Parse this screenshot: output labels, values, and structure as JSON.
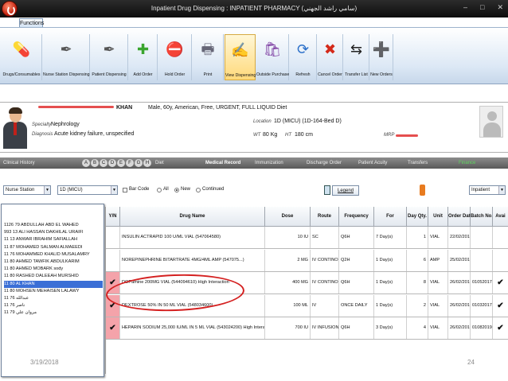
{
  "window": {
    "title": "Inpatient Drug Dispensing : INPATIENT PHARMACY (سامي راشد الجهني)"
  },
  "window_buttons": [
    "–",
    "□",
    "✕"
  ],
  "ribbon_tab": "Functions",
  "toolbar": [
    {
      "label": "Drugs/Consumables",
      "icon": "pill-icon",
      "glyph": "💊",
      "color": "#c8281e"
    },
    {
      "label": "Nurse Station Dispensing",
      "icon": "pen-icon",
      "glyph": "✒",
      "color": "#555"
    },
    {
      "label": "Patient Dispensing",
      "icon": "pen-icon",
      "glyph": "✒",
      "color": "#555"
    },
    {
      "label": "Add Order",
      "icon": "plus-icon",
      "glyph": "✚",
      "color": "#3aa52e"
    },
    {
      "label": "Hold Order",
      "icon": "stop-icon",
      "glyph": "⛔",
      "color": "#d42a1a"
    },
    {
      "label": "Print",
      "icon": "printer-icon",
      "glyph": "🖶",
      "color": "#667"
    },
    {
      "label": "View Dispensing",
      "icon": "pen-paper-icon",
      "glyph": "✍",
      "color": "#666"
    },
    {
      "label": "Outside Purchase",
      "icon": "bag-icon",
      "glyph": "🛍",
      "color": "#7b3aa0"
    },
    {
      "label": "Refresh",
      "icon": "refresh-icon",
      "glyph": "⟳",
      "color": "#2a6fc9"
    },
    {
      "label": "Cancel Order",
      "icon": "cancel-icon",
      "glyph": "✖",
      "color": "#d42a1a"
    },
    {
      "label": "Transfer List",
      "icon": "arrows-icon",
      "glyph": "⇆",
      "color": "#222"
    },
    {
      "label": "New Orders",
      "icon": "new-orders-icon",
      "glyph": "➕",
      "color": "#e0551f"
    }
  ],
  "patient": {
    "name": "KHAN",
    "summary": "Male, 60y, American, Free, URGENT, FULL LIQUID Diet",
    "specialty_label": "Specialty",
    "specialty": "Nephrology",
    "diagnosis_label": "Diagnosis",
    "diagnosis": "Acute kidney failure, unspecified",
    "location_label": "Location",
    "location": "1D (MICU) (1D-164-Bed D)",
    "wt_label": "WT",
    "wt": "80 Kg",
    "ht_label": "HT",
    "ht": "180 cm",
    "mrp_label": "MRP"
  },
  "nav": {
    "clinical_history": "Clinical History",
    "letters": [
      "A",
      "B",
      "C",
      "D",
      "E",
      "F",
      "G",
      "H"
    ],
    "diet": "Diet",
    "medical_record": "Medical Record",
    "immunization": "Immunization",
    "discharge_order": "Discharge Order",
    "patient_acuity": "Patient Acuity",
    "transfers": "Transfers",
    "finance": "Finance"
  },
  "filters": {
    "station_combo": "Nurse Station",
    "unit_combo": "1D (MICU)",
    "barcode_label": "Bar Code",
    "radio_all": "All",
    "radio_new": "New",
    "radio_continued": "Continued",
    "legend": "Legend",
    "type_combo": "Inpatient"
  },
  "patient_list": [
    "1126 79 ABDULLAH ABD EL WAHED",
    "993 13 ALI HASSAN DAKHILAL URAIFI",
    "11 13 ANWAR IBRAHIM SAFIALLAH",
    "11 87 MOHAMED SALMAN ALMAEEDI",
    "11 76 MOHAMMED KHALID MUSALAMRY",
    "11 80 AHMED TAWFIK ABDULKARIM",
    "11 80 AHMED MOBARK sody",
    "11 80 RASHED DALEEAH MURSHID",
    "11 80 AL KHAN",
    "11 80 MOHSEN MEHAISEN LALAWY",
    "11 76 عبدالله",
    "11 76 ناصر",
    "11 79 مروان علي"
  ],
  "grid": {
    "headers": [
      "Y/N",
      "Drug Name",
      "Dose",
      "Route",
      "Frequency",
      "For",
      "Day Qty.",
      "Unit",
      "Order Date",
      "Batch No.",
      "Avai"
    ],
    "rows": [
      {
        "yn": "",
        "drug": "INSULIN ACTRAPID 100 U/ML VIAL (547064580)",
        "dose": "10 IU",
        "route": "SC",
        "freq": "Q6H",
        "for": "7 Day(s)",
        "qty": "1",
        "unit": "VIAL",
        "date": "22/02/2017",
        "batch": "",
        "avail": ""
      },
      {
        "yn": "",
        "drug": "NOREPINEPHRINE BITARTRATE 4MG/4ML AMP (547075...)",
        "dose": "2 MG",
        "route": "IV CONTINOUS INF",
        "freq": "Q2H",
        "for": "1 Day(s)",
        "qty": "6",
        "unit": "AMP",
        "date": "25/02/2017",
        "batch": "",
        "avail": ""
      },
      {
        "yn": "✔",
        "drug": "DOPamine 200MG VIAL (544094610)    High Interaction",
        "dose": "400 MG",
        "route": "IV CONTINOUS INF",
        "freq": "Q6H",
        "for": "1 Day(s)",
        "qty": "8",
        "unit": "VIAL",
        "date": "26/02/2017",
        "batch": "01052017",
        "avail": "✔"
      },
      {
        "yn": "✔",
        "drug": "DEXTROSE 50% IN 50 ML VIAL (548034600)",
        "dose": "100 ML",
        "route": "IV",
        "freq": "ONCE DAILY",
        "for": "1 Day(s)",
        "qty": "2",
        "unit": "VIAL",
        "date": "26/02/2017",
        "batch": "01032017",
        "avail": "✔"
      },
      {
        "yn": "✔",
        "drug": "HEPARIN SODIUM 25,000 IU/ML IN 5 ML VIAL (543024200)    High Interaction",
        "dose": "700 IU",
        "route": "IV INFUSION",
        "freq": "Q6H",
        "for": "3 Day(s)",
        "qty": "4",
        "unit": "VIAL",
        "date": "26/02/2017",
        "batch": "01082019",
        "avail": "✔"
      }
    ]
  },
  "footer": {
    "date": "3/19/2018",
    "page": "24"
  }
}
